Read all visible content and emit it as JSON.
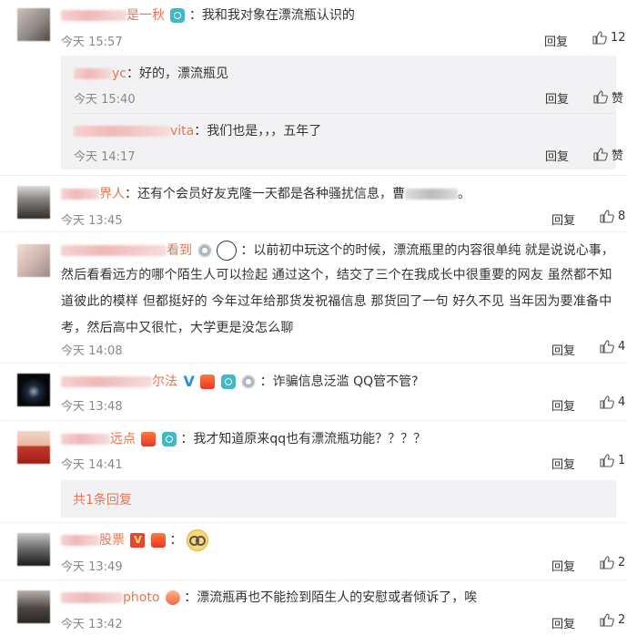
{
  "comments": [
    {
      "name_visible": "是一秋",
      "text": "：我和我对象在漂流瓶认识的",
      "time": "今天 15:57",
      "reply": "回复",
      "likes": "12",
      "replies": [
        {
          "name_visible": "yc",
          "text": "：好的，漂流瓶见",
          "time": "今天 15:40",
          "reply": "回复",
          "likes": "赞"
        },
        {
          "name_visible": "vita",
          "text": "：我们也是，，，五年了",
          "time": "今天 14:17",
          "reply": "回复",
          "likes": "赞"
        }
      ]
    },
    {
      "name_visible": "界人",
      "text": "：还有个会员好友克隆一天都是各种骚扰信息，曹",
      "tail": "。",
      "time": "今天 13:45",
      "reply": "回复",
      "likes": "8"
    },
    {
      "name_visible": "看到",
      "lines": [
        "：以前初中玩这个的时候，漂流瓶里的内容很单纯 就是说说心事，",
        "然后看看远方的哪个陌生人可以捡起 通过这个，结交了三个在我成长中很重要的网友 虽然都不知",
        "道彼此的模样 但都挺好的 今年过年给那货发祝福信息 那货回了一句 好久不见 当年因为要准备中",
        "考，然后高中又很忙，大学更是没怎么聊"
      ],
      "time": "今天 14:08",
      "reply": "回复",
      "likes": "4"
    },
    {
      "name_visible": "尔法",
      "text": "：诈骗信息泛滥 QQ管不管?",
      "time": "今天 13:48",
      "reply": "回复",
      "likes": "4"
    },
    {
      "name_visible": "远点",
      "text": "：我才知道原来qq也有漂流瓶功能？？？？",
      "time": "今天 14:41",
      "reply": "回复",
      "likes": "1",
      "more_replies": "共1条回复"
    },
    {
      "name_visible": "股票",
      "text": "：",
      "time": "今天 13:49",
      "reply": "回复",
      "likes": "2"
    },
    {
      "name_visible": "photo",
      "text": "：漂流瓶再也不能捡到陌生人的安慰或者倾诉了，唉",
      "time": "今天 13:42",
      "reply": "回复",
      "likes": "2"
    }
  ],
  "icons": {
    "thumb": "thumbs-up-icon",
    "camera_badge": "camera-badge-icon",
    "vip_badge": "vip-badge-icon"
  },
  "colors": {
    "username": "#eb7350",
    "time": "#888888",
    "sub_background": "#f2f2f5"
  }
}
